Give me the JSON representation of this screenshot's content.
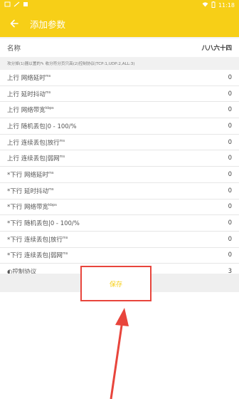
{
  "status": {
    "left_icons": [
      "sim-icon",
      "signal-icon",
      "square-icon"
    ],
    "right_icons": [
      "wifi-icon",
      "battery-icon"
    ],
    "time": "11:18"
  },
  "header": {
    "title": "添加参数",
    "back_icon": "arrow-left-icon"
  },
  "name": {
    "label": "名称",
    "value": "八八六十四"
  },
  "description": "攻分掉(1)器以置的✎ 收分符分页只高(2)控制协议(TCP:1,UDP:2,ALL:3)",
  "params": [
    {
      "prefix": "",
      "label": "上行 网络延时",
      "unit": "ms",
      "value": "0"
    },
    {
      "prefix": "",
      "label": "上行 延时抖动",
      "unit": "ms",
      "value": "0"
    },
    {
      "prefix": "",
      "label": "上行 网络带宽",
      "unit": "kbps",
      "value": "0"
    },
    {
      "prefix": "",
      "label": "上行 随机丢包|0 - 100/%",
      "unit": "",
      "value": "0"
    },
    {
      "prefix": "",
      "label": "上行 连续丢包|放行",
      "unit": "ms",
      "value": "0"
    },
    {
      "prefix": "",
      "label": "上行 连续丢包|弱网",
      "unit": "ms",
      "value": "0"
    },
    {
      "prefix": "*",
      "label": "下行 网络延时",
      "unit": "ms",
      "value": "0"
    },
    {
      "prefix": "*",
      "label": "下行 延时抖动",
      "unit": "ms",
      "value": "0"
    },
    {
      "prefix": "*",
      "label": "下行 网络带宽",
      "unit": "kbps",
      "value": "0"
    },
    {
      "prefix": "*",
      "label": "下行 随机丢包|0 - 100/%",
      "unit": "",
      "value": "0"
    },
    {
      "prefix": "*",
      "label": "下行 连续丢包|放行",
      "unit": "ms",
      "value": "0"
    },
    {
      "prefix": "*",
      "label": "下行 连续丢包|弱网",
      "unit": "ms",
      "value": "0"
    },
    {
      "prefix": "◐",
      "label": "控制协议",
      "unit": "",
      "value": "3"
    }
  ],
  "save_label": "保存",
  "colors": {
    "header": "#f7cf17",
    "highlight": "#e8453c"
  }
}
